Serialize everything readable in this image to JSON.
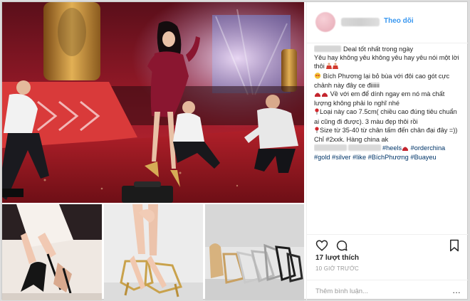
{
  "header": {
    "follow_label": "Theo dõi",
    "separator": "•"
  },
  "caption": {
    "lines": [
      "Deal tốt nhất trong ngày",
      "Yêu hay không yêu không yêu hay yêu nói một lời thôi",
      "Bích Phương lại bỏ bùa với đôi cao gót cực chảnh này đây ce điiiiii",
      "Về với em để dính ngay em nó mà chất lượng không phải lo nghĩ nhé",
      "Loại này cao 7.5cm( chiều cao đúng tiêu chuẩn ai cũng đi được). 3 màu đẹp thôi rồi",
      "Size từ 35-40 từ chân tấm đến chân đại đây =))",
      "Chỉ #2xxk. Hàng china ak"
    ],
    "hashtags_line1": [
      "#heels",
      "#orderchina"
    ],
    "hashtags_line2": [
      "#gold",
      "#silver",
      "#like",
      "#BíchPhương",
      "#Buayeu"
    ]
  },
  "stats": {
    "likes": "17 lượt thích",
    "time_ago": "10 GIỜ TRƯỚC"
  },
  "comment": {
    "placeholder": "Thêm bình luận...",
    "more": "..."
  },
  "icons": {
    "like": "heart-icon",
    "comment": "comment-icon",
    "save": "bookmark-icon",
    "more": "ellipsis-icon"
  },
  "colors": {
    "accent": "#3897f0",
    "hashtag": "#003569",
    "text": "#262626",
    "muted": "#999999"
  }
}
